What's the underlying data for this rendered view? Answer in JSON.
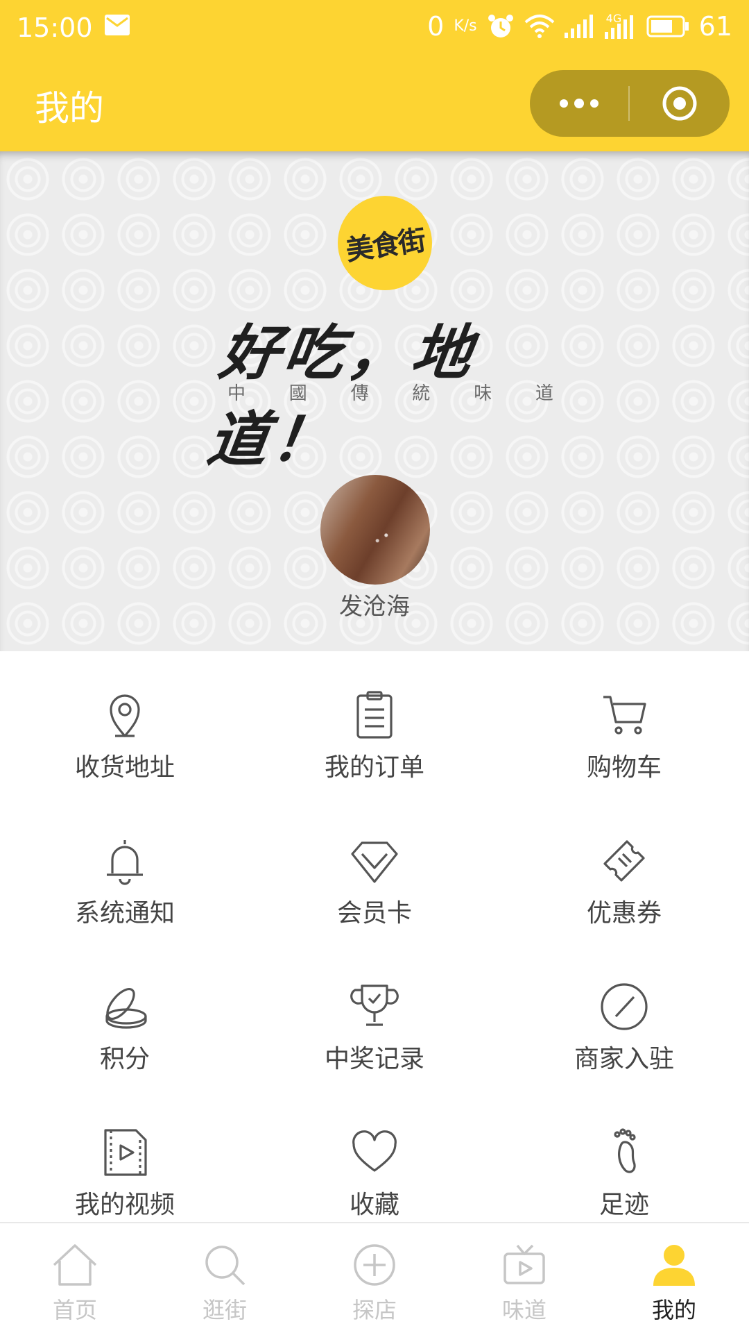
{
  "status_bar": {
    "time": "15:00",
    "net_speed_main": "0",
    "net_speed_unit": "K/s",
    "signal_label": "4G",
    "battery_level": "61"
  },
  "nav": {
    "title": "我的"
  },
  "hero": {
    "logo_text": "美食街",
    "slogan": "好吃，地道！",
    "slogan_sub": [
      "中",
      "國",
      "傳",
      "統",
      "味",
      "道"
    ],
    "username": "发沧海"
  },
  "menu": [
    {
      "label": "收货地址",
      "icon": "location-pin-icon"
    },
    {
      "label": "我的订单",
      "icon": "clipboard-icon"
    },
    {
      "label": "购物车",
      "icon": "cart-icon"
    },
    {
      "label": "系统通知",
      "icon": "bell-icon"
    },
    {
      "label": "会员卡",
      "icon": "diamond-icon"
    },
    {
      "label": "优惠券",
      "icon": "ticket-icon"
    },
    {
      "label": "积分",
      "icon": "coins-icon"
    },
    {
      "label": "中奖记录",
      "icon": "trophy-icon"
    },
    {
      "label": "商家入驻",
      "icon": "pen-circle-icon"
    },
    {
      "label": "我的视频",
      "icon": "video-file-icon"
    },
    {
      "label": "收藏",
      "icon": "heart-icon"
    },
    {
      "label": "足迹",
      "icon": "footprint-icon"
    }
  ],
  "tabs": [
    {
      "label": "首页",
      "icon": "home-icon",
      "active": false
    },
    {
      "label": "逛街",
      "icon": "search-icon",
      "active": false
    },
    {
      "label": "探店",
      "icon": "plus-circle-icon",
      "active": false
    },
    {
      "label": "味道",
      "icon": "tv-icon",
      "active": false
    },
    {
      "label": "我的",
      "icon": "user-icon",
      "active": true
    }
  ],
  "colors": {
    "brand_yellow": "#FDD432",
    "capsule": "#B59A22",
    "icon_stroke": "#555555",
    "tab_inactive": "#c6c6c6",
    "tab_active_icon": "#FDD432"
  }
}
